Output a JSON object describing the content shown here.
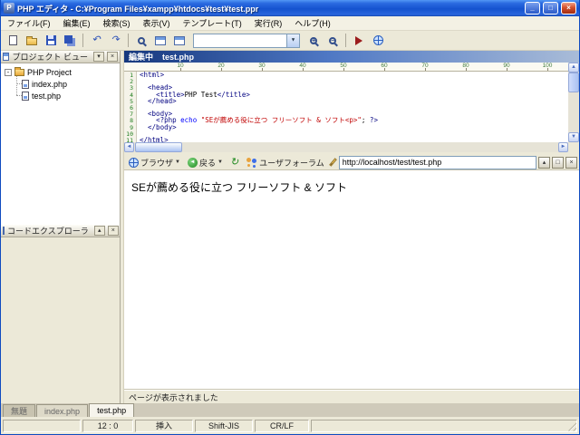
{
  "window": {
    "title": "PHP エディタ - C:¥Program Files¥xampp¥htdocs¥test¥test.ppr"
  },
  "menu": {
    "items": [
      "ファイル(F)",
      "編集(E)",
      "検索(S)",
      "表示(V)",
      "テンプレート(T)",
      "実行(R)",
      "ヘルプ(H)"
    ]
  },
  "toolbar": {
    "combo_value": "",
    "icons": [
      "new-file",
      "open-folder",
      "save",
      "save-all",
      "undo",
      "redo",
      "search",
      "project-view",
      "code-explorer",
      "chevron-down",
      "zoom-in",
      "zoom-out",
      "run",
      "browser-preview"
    ]
  },
  "sidebar": {
    "project_view": {
      "title": "プロジェクト ビュー",
      "root": "PHP Project",
      "files": [
        "index.php",
        "test.php"
      ]
    },
    "code_explorer": {
      "title": "コードエクスプローラ"
    }
  },
  "editor": {
    "status_label": "編集中",
    "filename": "test.php",
    "ruler": [
      "10",
      "20",
      "30",
      "40",
      "50",
      "60",
      "70",
      "80",
      "90",
      "100"
    ],
    "syntax_colors": {
      "tag": "#000080",
      "keyword": "#0000ff",
      "string": "#c00000",
      "plain": "#000000"
    },
    "lines": [
      [
        {
          "t": "<html>",
          "c": "tag"
        }
      ],
      [],
      [
        {
          "t": "  ",
          "c": "pl"
        },
        {
          "t": "<head>",
          "c": "tag"
        }
      ],
      [
        {
          "t": "    ",
          "c": "pl"
        },
        {
          "t": "<title>",
          "c": "tag"
        },
        {
          "t": "PHP Test",
          "c": "pl"
        },
        {
          "t": "</title>",
          "c": "tag"
        }
      ],
      [
        {
          "t": "  ",
          "c": "pl"
        },
        {
          "t": "</head>",
          "c": "tag"
        }
      ],
      [],
      [
        {
          "t": "  ",
          "c": "pl"
        },
        {
          "t": "<body>",
          "c": "tag"
        }
      ],
      [
        {
          "t": "    ",
          "c": "pl"
        },
        {
          "t": "<?php ",
          "c": "php"
        },
        {
          "t": "echo ",
          "c": "kw"
        },
        {
          "t": "\"SEが薦める役に立つ フリーソフト & ソフト<p>\"",
          "c": "str"
        },
        {
          "t": ";",
          "c": "pl"
        },
        {
          "t": " ?>",
          "c": "php"
        }
      ],
      [
        {
          "t": "  ",
          "c": "pl"
        },
        {
          "t": "</body>",
          "c": "tag"
        }
      ],
      [],
      [
        {
          "t": "</html>",
          "c": "tag"
        }
      ]
    ]
  },
  "browser": {
    "browser_button": "ブラウザ",
    "back_button": "戻る",
    "forum_button": "ユーザフォーラム",
    "url": "http://localhost/test/test.php",
    "content": "SEが薦める役に立つ フリーソフト & ソフト",
    "status": "ページが表示されました"
  },
  "tabs": {
    "items": [
      "無題",
      "index.php",
      "test.php"
    ],
    "active": "test.php"
  },
  "statusbar": {
    "position": "12 : 0",
    "mode": "挿入",
    "encoding": "Shift-JIS",
    "linebreak": "CR/LF"
  }
}
